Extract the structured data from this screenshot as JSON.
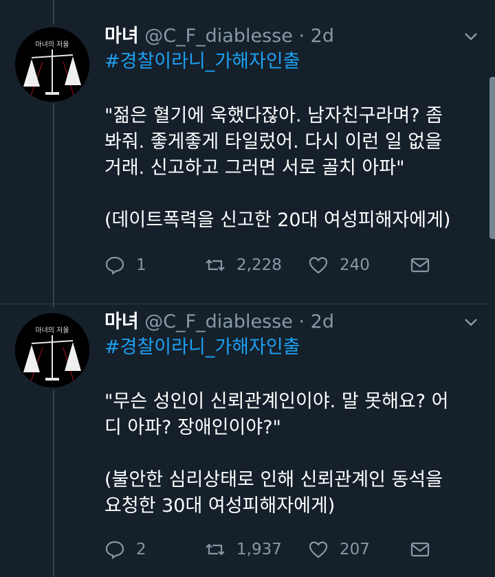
{
  "tweets": [
    {
      "name": "마녀",
      "handle": "@C_F_diablesse",
      "dot": "·",
      "time": "2d",
      "hashtag": "#경찰이라니_가해자인출",
      "body": "\"젊은 혈기에 욱했다잖아. 남자친구라며? 좀\n봐줘. 좋게좋게 타일렀어. 다시 이런 일 없을\n거래. 신고하고 그러면 서로 골치 아파\"\n\n(데이트폭력을 신고한 20대 여성피해자에게)",
      "replies": "1",
      "retweets": "2,228",
      "likes": "240"
    },
    {
      "name": "마녀",
      "handle": "@C_F_diablesse",
      "dot": "·",
      "time": "2d",
      "hashtag": "#경찰이라니_가해자인출",
      "body": "\"무슨 성인이 신뢰관계인이야. 말 못해요? 어\n디 아파? 장애인이야?\"\n\n(불안한 심리상태로 인해 신뢰관계인 동석을\n요청한 30대 여성피해자에게)",
      "replies": "2",
      "retweets": "1,937",
      "likes": "207"
    }
  ],
  "avatar": {
    "title": "마녀의 저울",
    "colors": {
      "background": "#000000",
      "scale": "#e8e8e8",
      "accent": "#b0121b"
    }
  },
  "icons": {
    "reply": "reply-icon",
    "retweet": "retweet-icon",
    "like": "heart-icon",
    "dm": "envelope-icon",
    "caret": "chevron-down-icon"
  },
  "theme": {
    "background": "#15202b",
    "link": "#1da1f2",
    "muted": "#8899a6",
    "line": "#38444d"
  }
}
